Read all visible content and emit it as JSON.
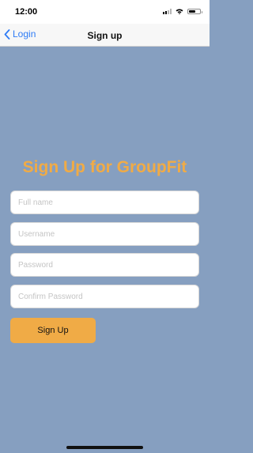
{
  "status_bar": {
    "time": "12:00"
  },
  "nav": {
    "back_label": "Login",
    "title": "Sign up"
  },
  "form": {
    "heading": "Sign Up for GroupFit",
    "full_name_placeholder": "Full name",
    "username_placeholder": "Username",
    "password_placeholder": "Password",
    "confirm_password_placeholder": "Confirm Password",
    "submit_label": "Sign Up"
  },
  "colors": {
    "background": "#869fc0",
    "accent": "#f0ab46",
    "link": "#2f7cf6"
  },
  "icons": [
    "signal-icon",
    "wifi-icon",
    "battery-icon",
    "chevron-left-icon"
  ]
}
